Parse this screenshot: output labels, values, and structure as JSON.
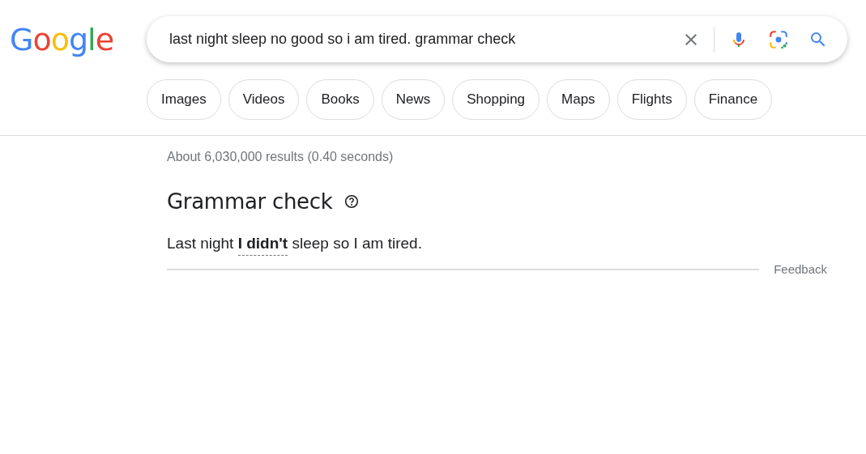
{
  "logo": "Google",
  "search": {
    "value": "last night sleep no good so i am tired. grammar check"
  },
  "chips": [
    {
      "label": "Images"
    },
    {
      "label": "Videos"
    },
    {
      "label": "Books"
    },
    {
      "label": "News"
    },
    {
      "label": "Shopping"
    },
    {
      "label": "Maps"
    },
    {
      "label": "Flights"
    },
    {
      "label": "Finance"
    }
  ],
  "result_stats": "About 6,030,000 results (0.40 seconds)",
  "grammar_card": {
    "title": "Grammar check",
    "correction": "Last night **I didn't** sleep so I am tired.",
    "feedback": "Feedback"
  }
}
